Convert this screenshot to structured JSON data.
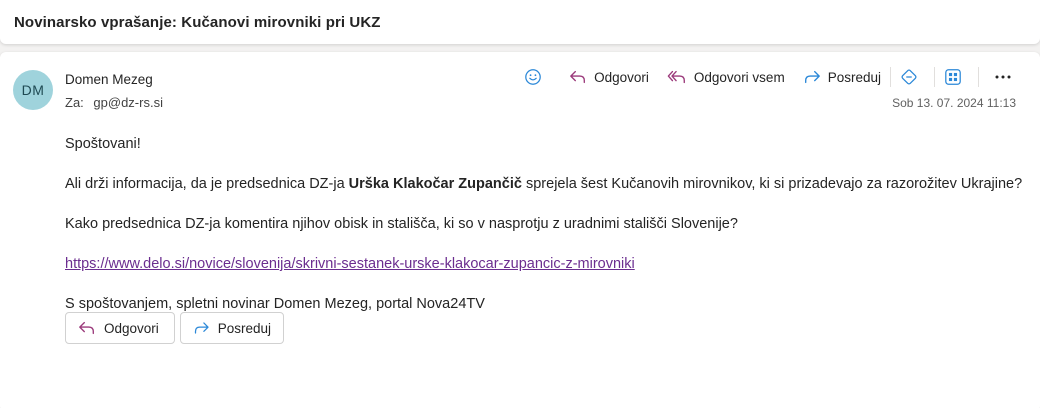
{
  "subject": "Novinarsko vprašanje: Kučanovi mirovniki pri UKZ",
  "sender": {
    "initials": "DM",
    "name": "Domen Mezeg",
    "to_label": "Za:",
    "to_address": "gp@dz-rs.si",
    "datetime": "Sob 13. 07. 2024 11:13"
  },
  "actions": {
    "emoji_icon": "emoji-icon",
    "reply": "Odgovori",
    "reply_all": "Odgovori vsem",
    "forward": "Posreduj",
    "accent": "#2b88d8"
  },
  "body": {
    "greeting": "Spoštovani!",
    "p1_pre": "Ali drži informacija, da je predsednica DZ-ja ",
    "p1_bold": "Urška Klakočar Zupančič",
    "p1_post": " sprejela šest Kučanovih mirovnikov, ki si prizadevajo za razorožitev Ukrajine?",
    "p2": "Kako predsednica DZ-ja komentira njihov obisk in stališča, ki so v nasprotju z uradnimi stališči Slovenije?",
    "link": "https://www.delo.si/novice/slovenija/skrivni-sestanek-urske-klakocar-zupancic-z-mirovniki",
    "signature": "S spoštovanjem, spletni novinar Domen Mezeg, portal Nova24TV"
  },
  "footer": {
    "reply": "Odgovori",
    "forward": "Posreduj"
  }
}
